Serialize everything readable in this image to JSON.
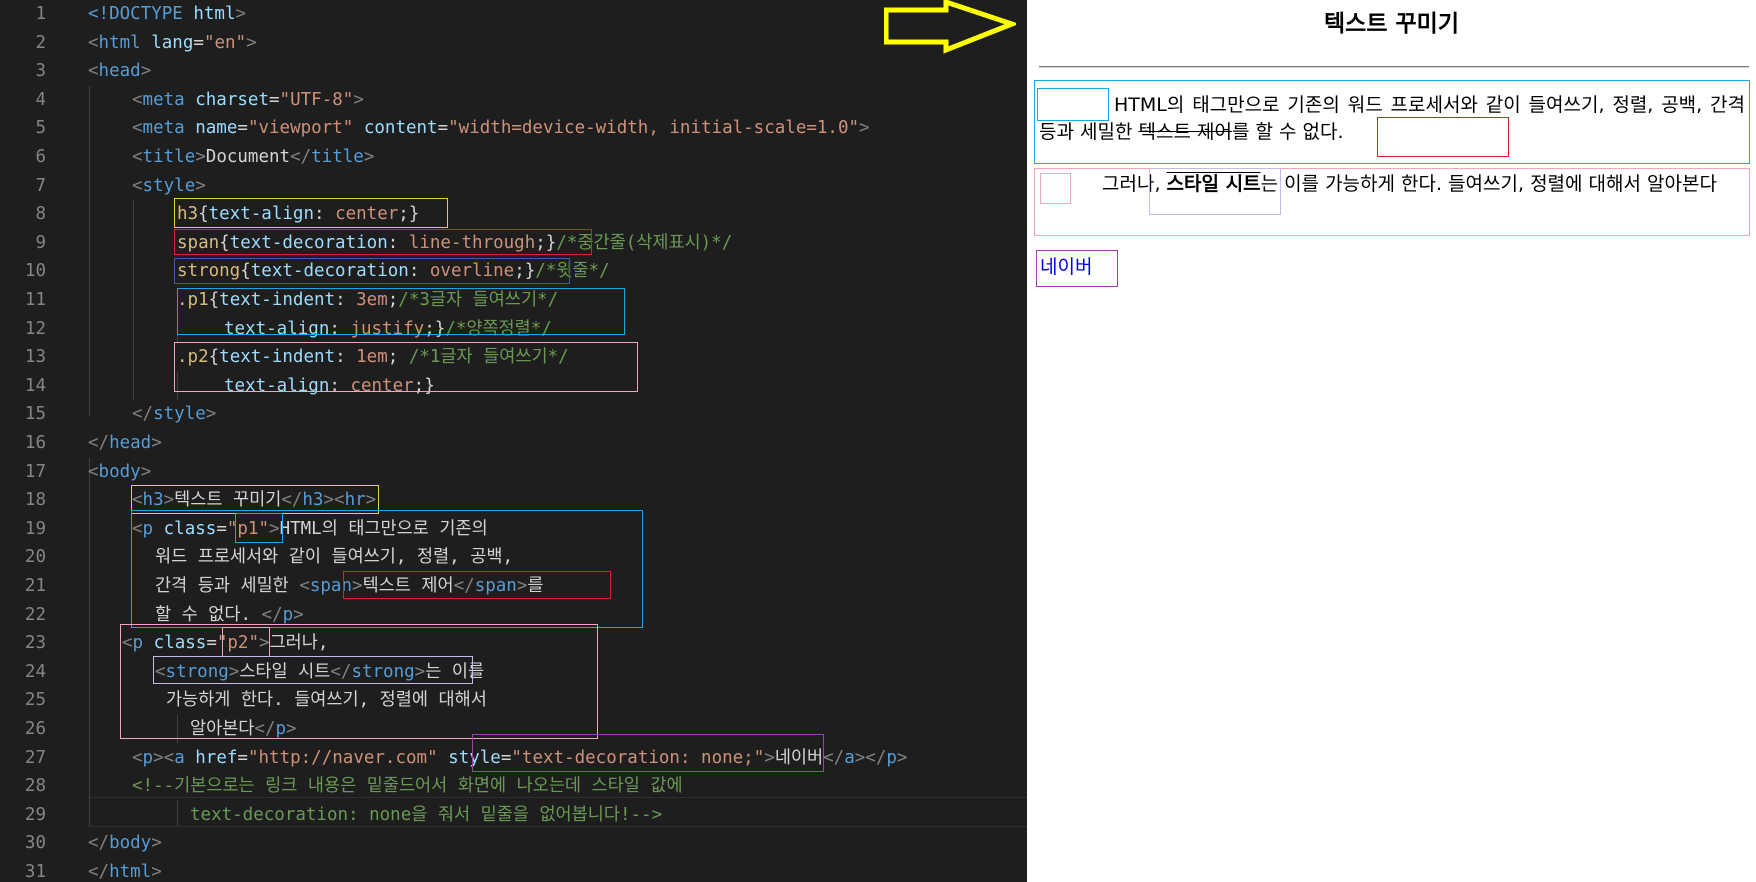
{
  "editor": {
    "line_numbers": [
      "1",
      "2",
      "3",
      "4",
      "5",
      "6",
      "7",
      "8",
      "9",
      "10",
      "11",
      "12",
      "13",
      "14",
      "15",
      "16",
      "17",
      "18",
      "19",
      "20",
      "21",
      "22",
      "23",
      "24",
      "25",
      "26",
      "27",
      "28",
      "29",
      "30",
      "31"
    ],
    "l1": {
      "a": "<!DOCTYPE",
      "b": " html",
      "c": ">"
    },
    "l2": {
      "a": "<",
      "b": "html",
      "c": " lang",
      "d": "=",
      "e": "\"en\"",
      "f": ">"
    },
    "l3": {
      "a": "<",
      "b": "head",
      "c": ">"
    },
    "l4": {
      "a": "<",
      "b": "meta",
      "c": " charset",
      "d": "=",
      "e": "\"UTF-8\"",
      "f": ">"
    },
    "l5": {
      "a": "<",
      "b": "meta",
      "c": " name",
      "d": "=",
      "e": "\"viewport\"",
      "f": " content",
      "g": "=",
      "h": "\"width=device-width, initial-scale=1.0\"",
      "i": ">"
    },
    "l6": {
      "a": "<",
      "b": "title",
      "c": ">",
      "d": "Document",
      "e": "</",
      "f": "title",
      "g": ">"
    },
    "l7": {
      "a": "<",
      "b": "style",
      "c": ">"
    },
    "l8": {
      "a": "h3",
      "b": "{",
      "c": "text-align",
      "d": ": ",
      "e": "center",
      "f": ";}"
    },
    "l9": {
      "a": "span",
      "b": "{",
      "c": "text-decoration",
      "d": ": ",
      "e": "line-through",
      "f": ";}",
      "g": "/*중간줄(삭제표시)*/"
    },
    "l10": {
      "a": "strong",
      "b": "{",
      "c": "text-decoration",
      "d": ": ",
      "e": "overline",
      "f": ";}",
      "g": "/*윗줄*/"
    },
    "l11": {
      "a": ".p1",
      "b": "{",
      "c": "text-indent",
      "d": ": ",
      "e": "3em",
      "f": ";",
      "g": "/*3글자 들여쓰기*/"
    },
    "l12": {
      "a": "text-align",
      "b": ": ",
      "c": "justify",
      "d": ";}",
      "e": "/*양쪽정렬*/"
    },
    "l13": {
      "a": ".p2",
      "b": "{",
      "c": "text-indent",
      "d": ": ",
      "e": "1em",
      "f": "; ",
      "g": "/*1글자 들여쓰기*/"
    },
    "l14": {
      "a": "text-align",
      "b": ": ",
      "c": "center",
      "d": ";}"
    },
    "l15": {
      "a": "</",
      "b": "style",
      "c": ">"
    },
    "l16": {
      "a": "</",
      "b": "head",
      "c": ">"
    },
    "l17": {
      "a": "<",
      "b": "body",
      "c": ">"
    },
    "l18": {
      "a": "<",
      "b": "h3",
      "c": ">",
      "d": "텍스트 꾸미기",
      "e": "</",
      "f": "h3",
      "g": ">",
      "h": "<",
      "i": "hr",
      "j": ">"
    },
    "l19": {
      "a": "<",
      "b": "p",
      "c": " class",
      "d": "=",
      "e": "\"p1\"",
      "f": ">",
      "g": "HTML의 태그만으로 기존의"
    },
    "l20": {
      "a": "워드 프로세서와 같이 들여쓰기, 정렬, 공백,"
    },
    "l21": {
      "a": "간격 등과 세밀한 ",
      "b": "<",
      "c": "span",
      "d": ">",
      "e": "텍스트 제어",
      "f": "</",
      "g": "span",
      "h": ">",
      "i": "를"
    },
    "l22": {
      "a": "할 수 없다. ",
      "b": "</",
      "c": "p",
      "d": ">"
    },
    "l23": {
      "a": "<",
      "b": "p",
      "c": " class",
      "d": "=",
      "e": "\"p2\"",
      "f": ">",
      "g": "그러나,"
    },
    "l24": {
      "a": "<",
      "b": "strong",
      "c": ">",
      "d": "스타일 시트",
      "e": "</",
      "f": "strong",
      "g": ">",
      "h": "는 이를"
    },
    "l25": {
      "a": "가능하게 한다. 들여쓰기, 정렬에 대해서"
    },
    "l26": {
      "a": "알아본다",
      "b": "</",
      "c": "p",
      "d": ">"
    },
    "l27": {
      "a": "<",
      "b": "p",
      "c": ">",
      "d": "<",
      "e": "a",
      "f": " href",
      "g": "=",
      "h": "\"http://naver.com\"",
      "i": " style",
      "j": "=",
      "k": "\"text-decoration: none;\"",
      "l": ">",
      "m": "네이버",
      "n": "</",
      "o": "a",
      "p": ">",
      "q": "</",
      "r": "p",
      "s": ">"
    },
    "l28": {
      "a": "<!--기본으로는 링크 내용은 밑줄드어서 화면에 나오는데 스타일 값에"
    },
    "l29": {
      "a": "text-decoration: none을 줘서 밑줄을 없어봅니다!-->"
    },
    "l30": {
      "a": "</",
      "b": "body",
      "c": ">"
    },
    "l31": {
      "a": "</",
      "b": "html",
      "c": ">"
    }
  },
  "preview": {
    "title": "텍스트 꾸미기",
    "p1_before": "HTML의 태그만으로 기존의 워드 프로세서와 같이 들여쓰기, 정렬, 공백, 간격 등과 세밀한 ",
    "p1_span": "텍스트 제어",
    "p1_after": "를 할 수 없다.",
    "p2_before": "그러나, ",
    "p2_strong": "스타일 시트",
    "p2_after": "는 이를 가능하게 한다. 들여쓰기, 정렬에 대해서 알아본다",
    "link_text": "네이버",
    "link_href": "http://naver.com"
  },
  "colors": {
    "editor_bg": "#1e1e1e",
    "arrow": "#ffff00",
    "box_yellow": "#e6d230",
    "box_red": "#e02020",
    "box_navy": "#3a5fa8",
    "box_blue": "#1aa6e6",
    "box_pink": "#f4a3c0",
    "box_lavender": "#c8b8e8",
    "box_purple": "#a040b0",
    "link": "#0000ee"
  },
  "icons": {
    "arrow": "right-arrow-icon"
  }
}
